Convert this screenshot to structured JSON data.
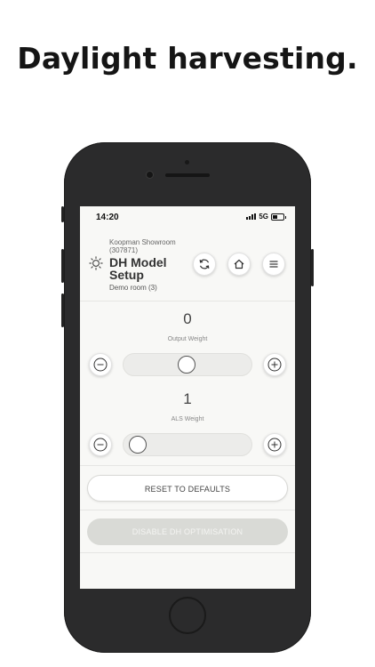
{
  "headline": "Daylight harvesting.",
  "status_bar": {
    "time": "14:20",
    "network": "5G"
  },
  "header": {
    "location_line1": "Koopman Showroom",
    "location_line2": "(307871)",
    "title": "DH Model Setup",
    "room": "Demo room (3)",
    "icons": [
      "sun-icon",
      "refresh-icon",
      "home-icon",
      "menu-icon"
    ]
  },
  "output_weight": {
    "value": "0",
    "label": "Output Weight",
    "slider_fraction": 0.5
  },
  "als_weight": {
    "value": "1",
    "label": "ALS Weight",
    "slider_fraction": 0.0
  },
  "buttons": {
    "reset": "RESET TO DEFAULTS",
    "disable": "DISABLE DH OPTIMISATION"
  }
}
